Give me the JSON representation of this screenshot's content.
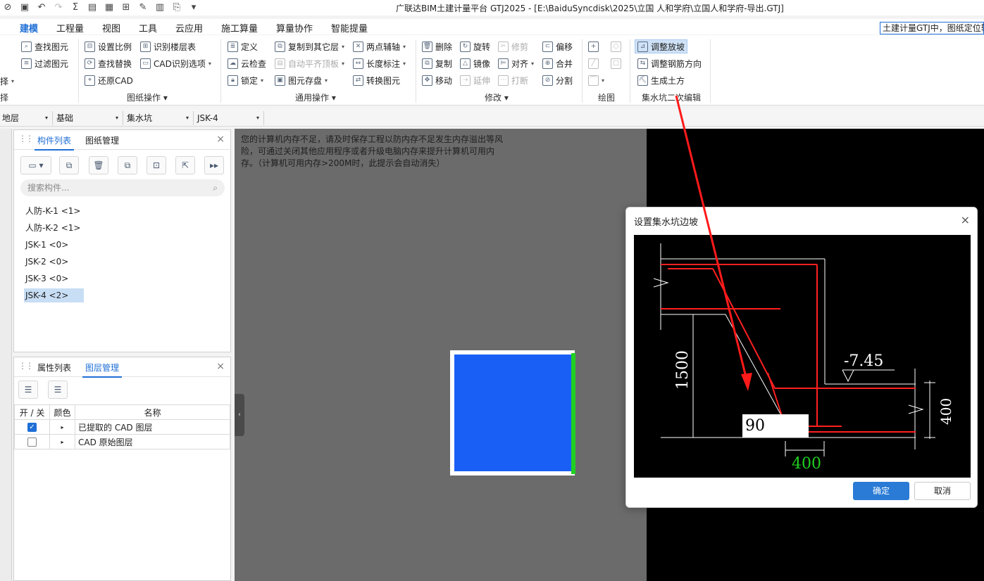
{
  "title": "广联达BIM土建计量平台 GTJ2025 - [E:\\BaiduSyncdisk\\2025\\立国 人和学府\\立国人和学府-导出.GTJ]",
  "ribbon_tabs": [
    "建模",
    "工程量",
    "视图",
    "工具",
    "云应用",
    "施工算量",
    "算量协作",
    "智能提量"
  ],
  "active_tab": "建模",
  "tab_search_text": "土建计量GTJ中，图纸定位转",
  "groups": {
    "partial_left": {
      "label": "择",
      "items": [
        "择"
      ]
    },
    "select": {
      "items": [
        "查找图元",
        "过滤图元"
      ]
    },
    "drawing_ops": {
      "label": "图纸操作",
      "items": [
        "设置比例",
        "识别楼层表",
        "查找替换",
        "CAD识别选项",
        "还原CAD"
      ]
    },
    "common_ops": {
      "label": "通用操作",
      "items": [
        "定义",
        "复制到其它层",
        "两点辅轴",
        "云检查",
        "自动平齐顶板",
        "长度标注",
        "锁定",
        "图元存盘",
        "转换图元"
      ]
    },
    "modify": {
      "label": "修改",
      "items": [
        "删除",
        "旋转",
        "修剪",
        "偏移",
        "复制",
        "镜像",
        "对齐",
        "合并",
        "移动",
        "延伸",
        "打断",
        "分割"
      ]
    },
    "draw": {
      "label": "绘图"
    },
    "sump_edit": {
      "label": "集水坑二次编辑",
      "items": [
        "调整放坡",
        "调整钢筋方向",
        "生成土方"
      ]
    }
  },
  "selectors": [
    "地层",
    "基础",
    "集水坑",
    "JSK-4"
  ],
  "component_panel": {
    "tabs": [
      "构件列表",
      "图纸管理"
    ],
    "search_placeholder": "搜索构件...",
    "items": [
      "人防-K-1 <1>",
      "人防-K-2 <1>",
      "JSK-1 <0>",
      "JSK-2 <0>",
      "JSK-3 <0>",
      "JSK-4 <2>"
    ],
    "selected_index": 5
  },
  "layer_panel": {
    "tabs": [
      "属性列表",
      "图层管理"
    ],
    "columns": [
      "开 / 关",
      "颜色",
      "名称"
    ],
    "rows": [
      {
        "name": "已提取的 CAD 图层",
        "checked": true
      },
      {
        "name": "CAD 原始图层",
        "checked": false
      }
    ]
  },
  "canvas": {
    "memory_warning": "您的计算机内存不足，请及时保存工程以防内存不足发生内存溢出等风险，可通过关闭其他应用程序或者升级电脑内存来提升计算机可用内存。（计算机可用内存>200M时，此提示会自动消失）",
    "colors": {
      "shape": "#1a5ff5",
      "edge": "#20d020",
      "background": "#6b6b6b"
    }
  },
  "dialog": {
    "title": "设置集水坑边坡",
    "slope_value": "90",
    "dims": {
      "depth": "1500",
      "elevation": "-7.45",
      "right": "400",
      "bottom": "400"
    },
    "ok_label": "确定",
    "cancel_label": "取消"
  },
  "icons": {
    "close": "×",
    "dropdown": "▾",
    "search": "⌕",
    "grip": "⠿"
  },
  "accent_color": "#1f6fd6"
}
